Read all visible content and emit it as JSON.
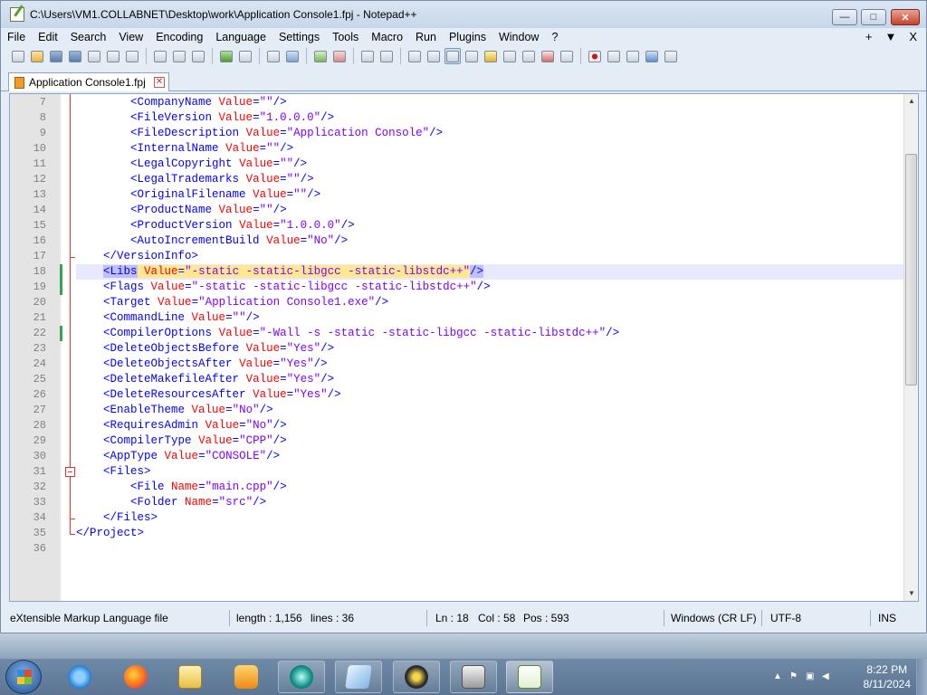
{
  "window": {
    "title": "C:\\Users\\VM1.COLLABNET\\Desktop\\work\\Application Console1.fpj - Notepad++",
    "min_label": "—",
    "max_label": "□",
    "close_label": "✕"
  },
  "menu": {
    "items": [
      "File",
      "Edit",
      "Search",
      "View",
      "Encoding",
      "Language",
      "Settings",
      "Tools",
      "Macro",
      "Run",
      "Plugins",
      "Window",
      "?"
    ],
    "right": [
      "+",
      "▼",
      "X"
    ]
  },
  "tab": {
    "label": "Application Console1.fpj",
    "close": "✕"
  },
  "editor": {
    "current_line": 18,
    "lines": [
      {
        "n": "7",
        "text": "        <CompanyName Value=\"\"/>"
      },
      {
        "n": "8",
        "text": "        <FileVersion Value=\"1.0.0.0\"/>"
      },
      {
        "n": "9",
        "text": "        <FileDescription Value=\"Application Console\"/>"
      },
      {
        "n": "10",
        "text": "        <InternalName Value=\"\"/>"
      },
      {
        "n": "11",
        "text": "        <LegalCopyright Value=\"\"/>"
      },
      {
        "n": "12",
        "text": "        <LegalTrademarks Value=\"\"/>"
      },
      {
        "n": "13",
        "text": "        <OriginalFilename Value=\"\"/>"
      },
      {
        "n": "14",
        "text": "        <ProductName Value=\"\"/>"
      },
      {
        "n": "15",
        "text": "        <ProductVersion Value=\"1.0.0.0\"/>"
      },
      {
        "n": "16",
        "text": "        <AutoIncrementBuild Value=\"No\"/>"
      },
      {
        "n": "17",
        "text": "    </VersionInfo>"
      },
      {
        "n": "18",
        "text": "    <Libs Value=\"-static -static-libgcc -static-libstdc++\"/>"
      },
      {
        "n": "19",
        "text": "    <Flags Value=\"-static -static-libgcc -static-libstdc++\"/>"
      },
      {
        "n": "20",
        "text": "    <Target Value=\"Application Console1.exe\"/>"
      },
      {
        "n": "21",
        "text": "    <CommandLine Value=\"\"/>"
      },
      {
        "n": "22",
        "text": "    <CompilerOptions Value=\"-Wall -s -static -static-libgcc -static-libstdc++\"/>"
      },
      {
        "n": "23",
        "text": "    <DeleteObjectsBefore Value=\"Yes\"/>"
      },
      {
        "n": "24",
        "text": "    <DeleteObjectsAfter Value=\"Yes\"/>"
      },
      {
        "n": "25",
        "text": "    <DeleteMakefileAfter Value=\"Yes\"/>"
      },
      {
        "n": "26",
        "text": "    <DeleteResourcesAfter Value=\"Yes\"/>"
      },
      {
        "n": "27",
        "text": "    <EnableTheme Value=\"No\"/>"
      },
      {
        "n": "28",
        "text": "    <RequiresAdmin Value=\"No\"/>"
      },
      {
        "n": "29",
        "text": "    <CompilerType Value=\"CPP\"/>"
      },
      {
        "n": "30",
        "text": "    <AppType Value=\"CONSOLE\"/>"
      },
      {
        "n": "31",
        "text": "    <Files>"
      },
      {
        "n": "32",
        "text": "        <File Name=\"main.cpp\"/>"
      },
      {
        "n": "33",
        "text": "        <Folder Name=\"src\"/>"
      },
      {
        "n": "34",
        "text": "    </Files>"
      },
      {
        "n": "35",
        "text": "</Project>"
      },
      {
        "n": "36",
        "text": ""
      }
    ]
  },
  "status": {
    "filetype": "eXtensible Markup Language file",
    "length": "length : 1,156",
    "lines": "lines : 36",
    "ln": "Ln : 18",
    "col": "Col : 58",
    "pos": "Pos : 593",
    "eol": "Windows (CR LF)",
    "encoding": "UTF-8",
    "mode": "INS"
  },
  "taskbar": {
    "time": "8:22 PM",
    "date": "8/11/2024"
  },
  "colors": {
    "tag": "#0000ff",
    "attr": "#ff0000",
    "value": "#8000ff",
    "current_line": "#e8e8ff",
    "changed_marker": "#37a34a",
    "fold": "#ff2b2b"
  }
}
